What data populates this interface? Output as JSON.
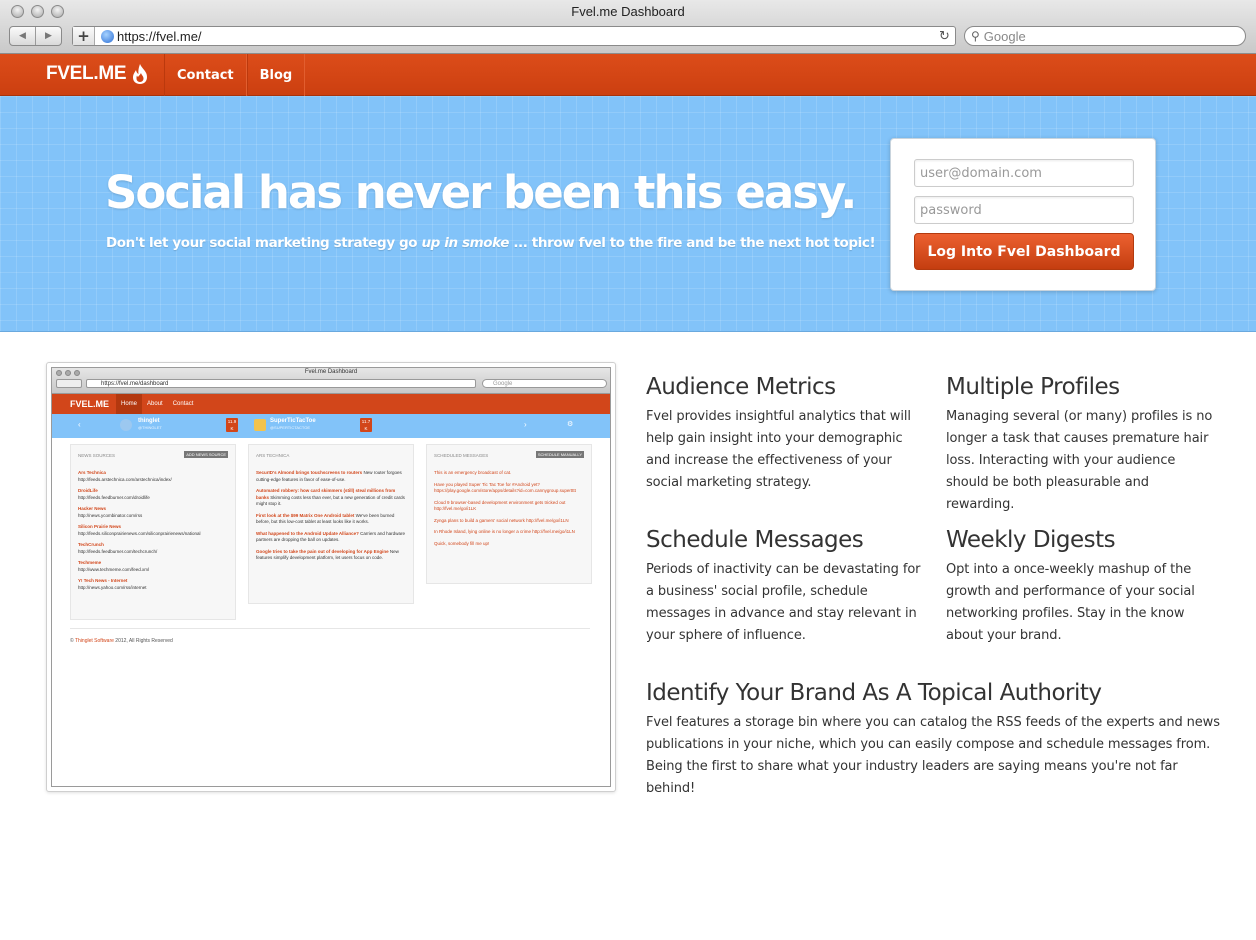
{
  "window": {
    "title": "Fvel.me Dashboard",
    "url": "https://fvel.me/",
    "search_placeholder": "Google"
  },
  "navbar": {
    "brand": "FVEL.ME",
    "links": [
      "Contact",
      "Blog"
    ],
    "color": "#d2461a"
  },
  "hero": {
    "headline": "Social has never been this easy.",
    "tagline_pre": "Don't let your social marketing strategy go ",
    "tagline_em": "up in smoke",
    "tagline_post": " ... throw fvel to the fire and be the next hot topic!",
    "background": "#82c3f9"
  },
  "login": {
    "email_placeholder": "user@domain.com",
    "password_placeholder": "password",
    "submit_label": "Log Into Fvel Dashboard"
  },
  "preview": {
    "window_title": "Fvel.me Dashboard",
    "url": "https://fvel.me/dashboard",
    "search": "Google",
    "brand": "FVEL.ME",
    "nav": [
      "Home",
      "About",
      "Contact"
    ],
    "accounts": [
      {
        "name": "thinglet",
        "handle": "@THINGLET",
        "count": "11.9 K"
      },
      {
        "name": "SuperTicTacToe",
        "handle": "@SUPERTICTACTOE",
        "count": "11.7 K"
      }
    ],
    "news_sources": {
      "heading": "NEWS SOURCES",
      "button": "ADD NEWS SOURCE",
      "items": [
        {
          "name": "Ars Technica",
          "url": "http://feeds.arstechnica.com/arstechnica/index/"
        },
        {
          "name": "DroidLife",
          "url": "http://feeds.feedburner.com/droidlife"
        },
        {
          "name": "Hacker News",
          "url": "http://news.ycombinator.com/rss"
        },
        {
          "name": "Silicon Prairie News",
          "url": "http://feeds.siliconprairienews.com/siliconprairienews/national"
        },
        {
          "name": "TechCrunch",
          "url": "http://feeds.feedburner.com/techcrunch/"
        },
        {
          "name": "Techmeme",
          "url": "http://www.techmeme.com/feed.xml"
        },
        {
          "name": "Y! Tech News - Internet",
          "url": "http://news.yahoo.com/rss/internet"
        }
      ]
    },
    "ars_technica": {
      "heading": "ARS TECHNICA",
      "items": [
        {
          "title": "SecurID's Almond brings touchscreens to routers",
          "text": " New router forgoes cutting-edge features in favor of ease-of-use."
        },
        {
          "title": "Automated robbery: how card skimmers (still) steal millions from banks",
          "text": " Skimming costs less than ever, but a new generation of credit cards might stop it."
        },
        {
          "title": "First look at the $99 Matrix One Android tablet",
          "text": " We've been burned before, but this low-cost tablet at least looks like it works."
        },
        {
          "title": "What happened to the Android Update Alliance?",
          "text": " Carriers and hardware partners are dropping the ball on updates."
        },
        {
          "title": "Google tries to take the pain out of developing for App Engine",
          "text": " New features simplify development platform, let users focus on code."
        }
      ]
    },
    "scheduled": {
      "heading": "SCHEDULED MESSAGES",
      "button": "SCHEDULE MANUALLY",
      "items": [
        "This is an emergency broadcast of cat.",
        "Have you played Super Tic Tac Toe for #Android yet? https://play.google.com/store/apps/details?id=com.cannygroup.supertttt",
        "Cloud 9 browser-based development environment gets tricked out http://fvel.me/go/i1LK",
        "Zynga plans to build a gamers' social network http://fvel.me/go/i1LN",
        "In Rhode Island, lying online is no longer a crime http://fvel.me/go/i1LN",
        "Quick, somebody fill me up!"
      ]
    },
    "footer_pre": "© ",
    "footer_link": "Thinglet Software",
    "footer_post": " 2012, All Rights Reserved"
  },
  "features": [
    {
      "title": "Audience Metrics",
      "text": "Fvel provides insightful analytics that will help gain insight into your demographic and increase the effectiveness of your social marketing strategy."
    },
    {
      "title": "Multiple Profiles",
      "text": "Managing several (or many) profiles is no longer a task that causes premature hair loss. Interacting with your audience should be both pleasurable and rewarding."
    },
    {
      "title": "Schedule Messages",
      "text": "Periods of inactivity can be devastating for a business' social profile, schedule messages in advance and stay relevant in your sphere of influence."
    },
    {
      "title": "Weekly Digests",
      "text": "Opt into a once-weekly mashup of the growth and performance of your social networking profiles. Stay in the know about your brand."
    },
    {
      "title": "Identify Your Brand As A Topical Authority",
      "text": "Fvel features a storage bin where you can catalog the RSS feeds of the experts and news publications in your niche, which you can easily compose and schedule messages from. Being the first to share what your industry leaders are saying means you're not far behind!"
    }
  ]
}
